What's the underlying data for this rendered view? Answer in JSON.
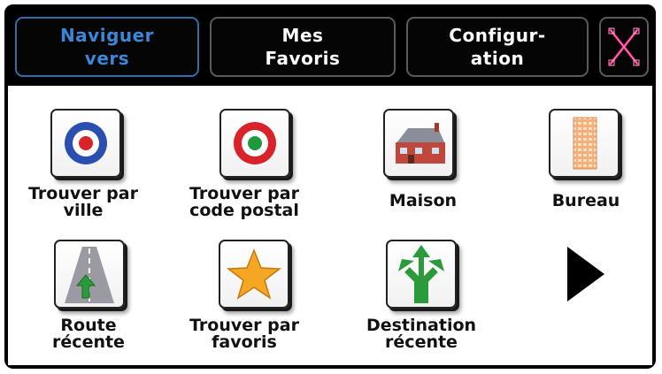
{
  "tabs": [
    {
      "label": "Naviguer\nvers",
      "active": true
    },
    {
      "label": "Mes\nFavoris",
      "active": false
    },
    {
      "label": "Configur-\nation",
      "active": false
    }
  ],
  "close_icon": "x-close-icon",
  "colors": {
    "active_tab_text": "#3a86d8",
    "active_tab_border": "#2f6ea8",
    "close_icon": "#e0207a"
  },
  "items": [
    {
      "label": "Trouver par\nville",
      "icon": "target-blue-red-icon"
    },
    {
      "label": "Trouver par\ncode postal",
      "icon": "target-red-green-icon"
    },
    {
      "label": "Maison",
      "icon": "house-icon"
    },
    {
      "label": "Bureau",
      "icon": "office-building-icon"
    },
    {
      "label": "Route\nrécente",
      "icon": "road-arrow-icon"
    },
    {
      "label": "Trouver par\nfavoris",
      "icon": "star-icon"
    },
    {
      "label": "Destination\nrécente",
      "icon": "split-arrow-icon"
    }
  ],
  "next_icon": "next-page-arrow-icon"
}
